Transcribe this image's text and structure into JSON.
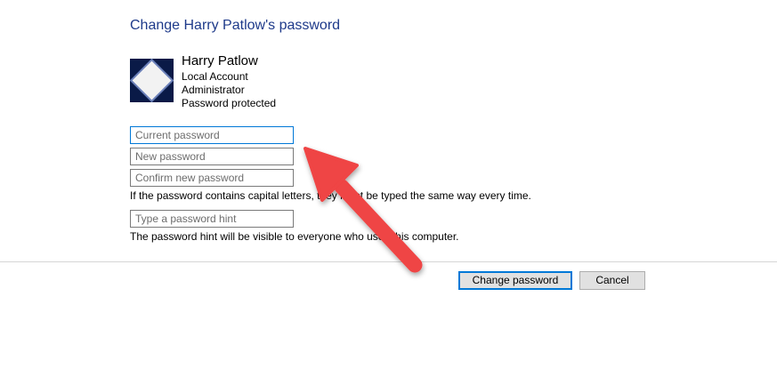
{
  "header": {
    "title": "Change Harry Patlow's password"
  },
  "user": {
    "name": "Harry Patlow",
    "account_type": "Local Account",
    "role": "Administrator",
    "status": "Password protected",
    "avatar_icon": "user-account-picture"
  },
  "form": {
    "current_password_placeholder": "Current password",
    "new_password_placeholder": "New password",
    "confirm_password_placeholder": "Confirm new password",
    "caps_note": "If the password contains capital letters, they must be typed the same way every time.",
    "hint_placeholder": "Type a password hint",
    "hint_note": "The password hint will be visible to everyone who uses this computer."
  },
  "buttons": {
    "change_label": "Change password",
    "cancel_label": "Cancel"
  },
  "annotation": {
    "icon": "red-arrow-pointer",
    "color": "#ef4444"
  },
  "colors": {
    "title": "#1e3a8a",
    "focus_border": "#0078d7",
    "button_bg": "#e1e1e1"
  }
}
